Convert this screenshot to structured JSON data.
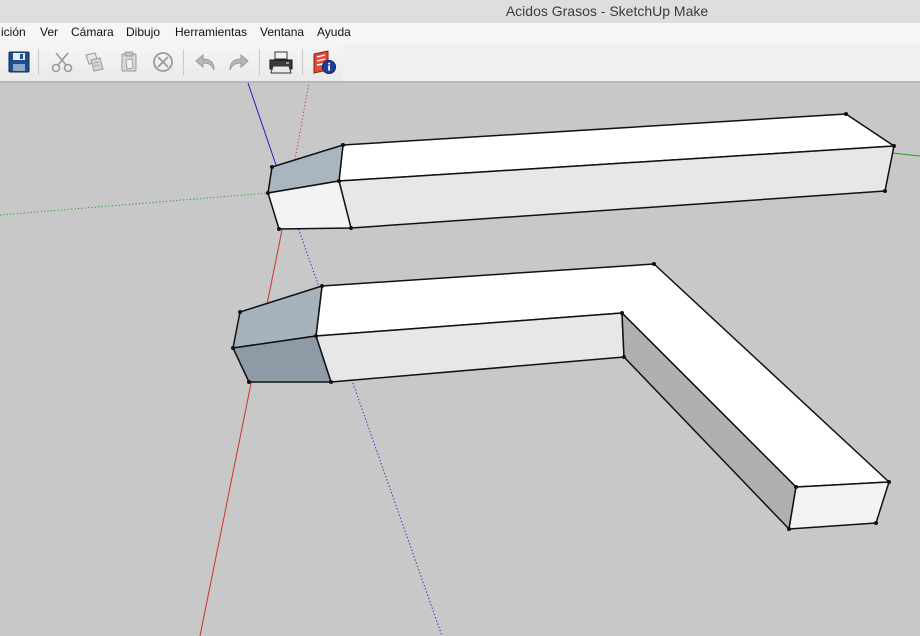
{
  "window": {
    "title": "Acidos Grasos - SketchUp Make"
  },
  "menu": {
    "items": [
      "ición",
      "Ver",
      "Cámara",
      "Dibujo",
      "Herramientas",
      "Ventana",
      "Ayuda"
    ]
  },
  "toolbar": {
    "buttons": [
      {
        "name": "save",
        "icon": "floppy-disk-icon",
        "enabled": true
      },
      {
        "name": "cut",
        "icon": "scissors-icon",
        "enabled": false
      },
      {
        "name": "copy",
        "icon": "copy-icon",
        "enabled": false
      },
      {
        "name": "paste",
        "icon": "paste-icon",
        "enabled": false
      },
      {
        "name": "erase",
        "icon": "erase-icon",
        "enabled": false
      },
      {
        "name": "undo",
        "icon": "undo-icon",
        "enabled": false
      },
      {
        "name": "redo",
        "icon": "redo-icon",
        "enabled": false
      },
      {
        "name": "print",
        "icon": "printer-icon",
        "enabled": true
      },
      {
        "name": "model-info",
        "icon": "model-info-icon",
        "enabled": true
      }
    ]
  },
  "colors": {
    "axis_red": "#d03030",
    "axis_green": "#2a9a2a",
    "axis_blue": "#2020c8",
    "viewport_bg": "#c8c8c8"
  }
}
